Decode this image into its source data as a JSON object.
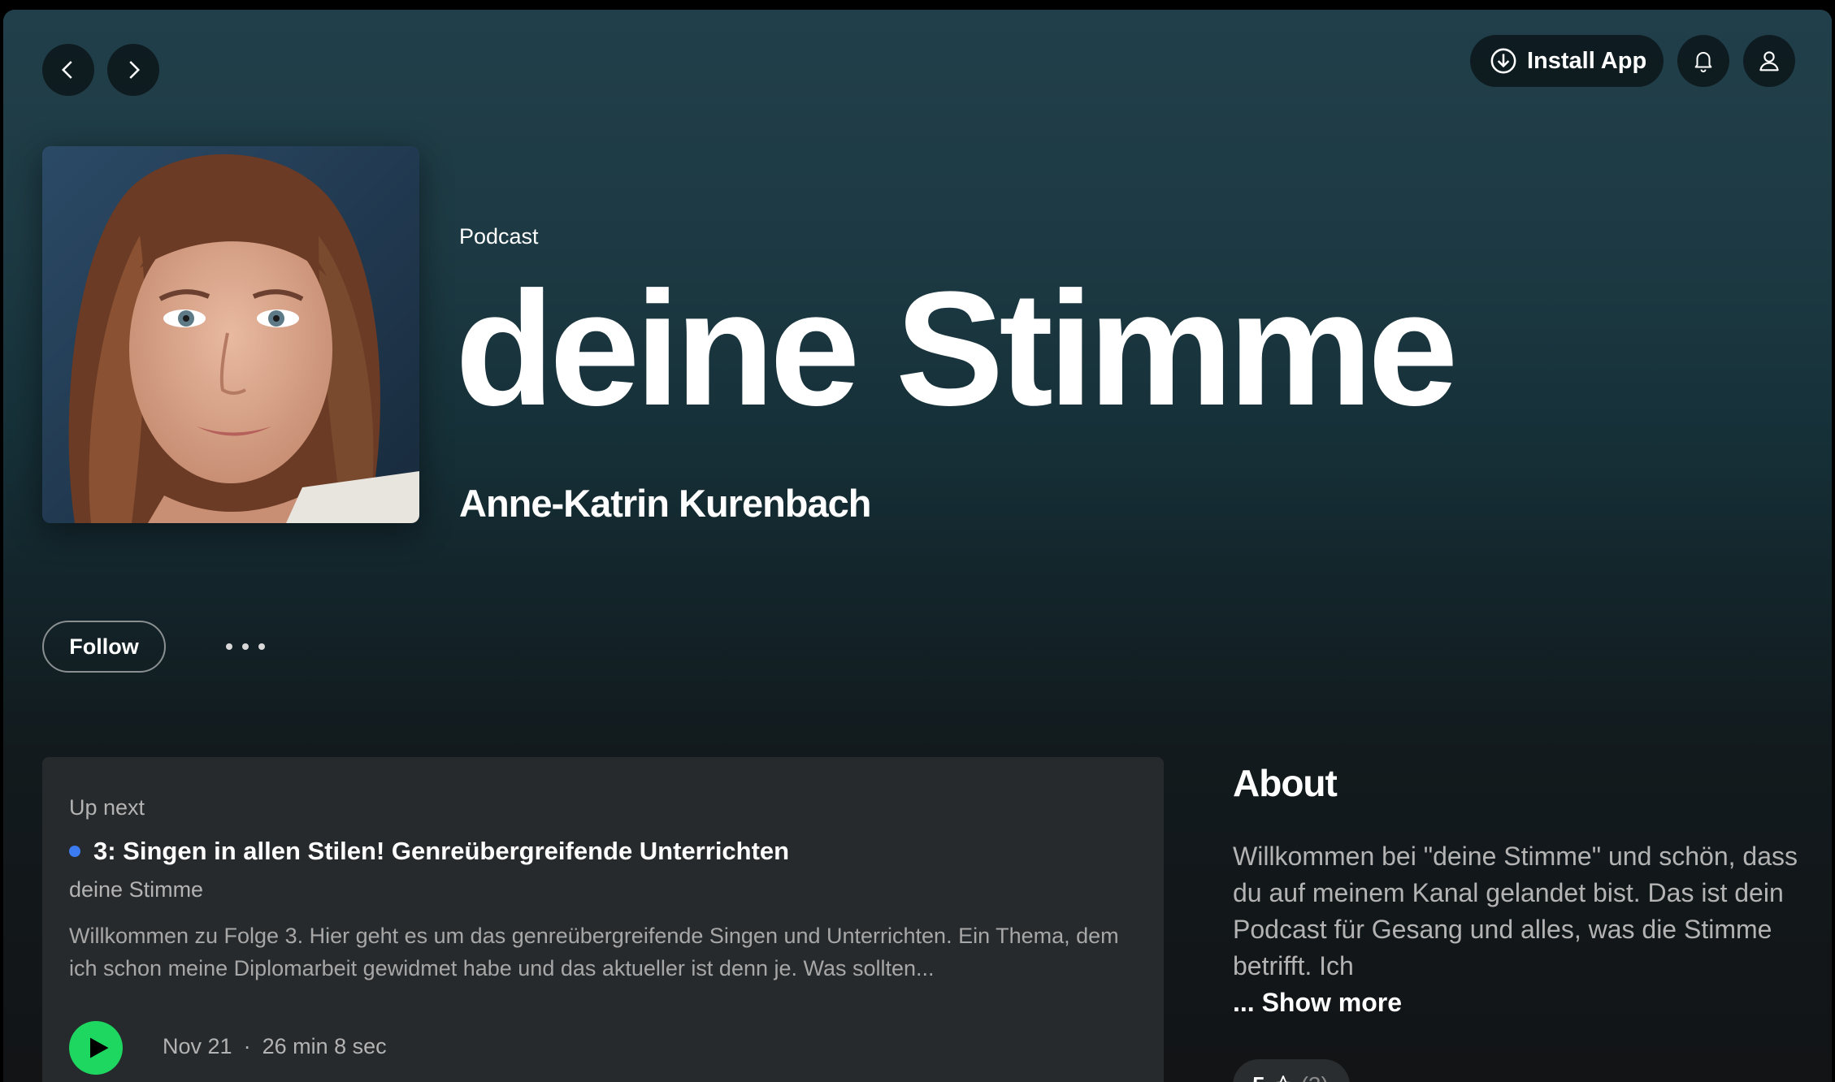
{
  "topbar": {
    "install_label": "Install App"
  },
  "show": {
    "type": "Podcast",
    "title": "deine Stimme",
    "author": "Anne-Katrin Kurenbach"
  },
  "actions": {
    "follow_label": "Follow"
  },
  "episode": {
    "section_label": "Up next",
    "title": "3: Singen in allen Stilen! Genreübergreifende Unterrichten",
    "show_name": "deine Stimme",
    "description": "Willkommen zu Folge 3. Hier geht es um das genreübergreifende Singen und Unterrichten. Ein Thema, dem ich schon meine Diplomarbeit gewidmet habe und das aktueller ist denn je. Was sollten...",
    "date": "Nov 21",
    "separator": "·",
    "duration": "26 min 8 sec"
  },
  "about": {
    "heading": "About",
    "text": "Willkommen bei \"deine Stimme\" und schön, dass du auf meinem Kanal gelandet bist. Das ist dein Podcast für Gesang und alles, was die Stimme betrifft. Ich",
    "show_more": "... Show more",
    "rating_value": "5",
    "rating_count": "(3)"
  },
  "colors": {
    "accent_green": "#1ed760",
    "new_dot_blue": "#3d7bf0"
  }
}
